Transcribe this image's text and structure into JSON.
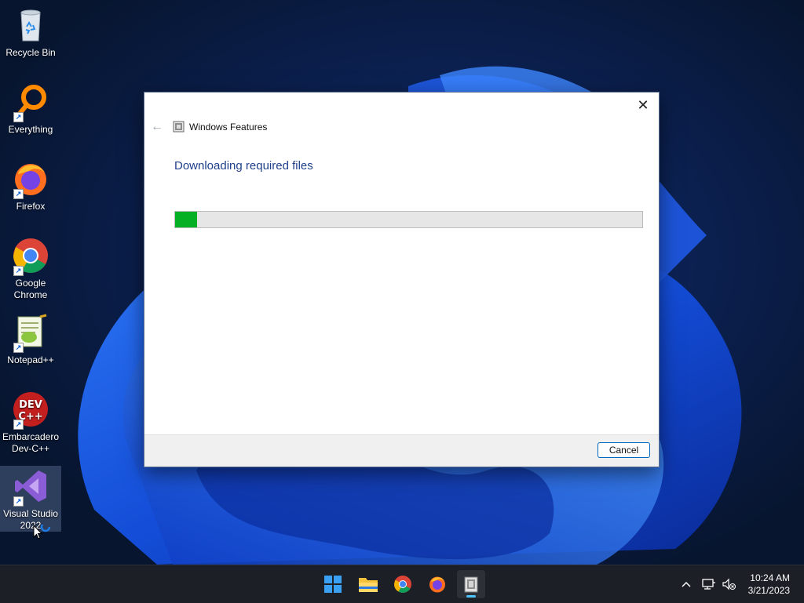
{
  "desktop": {
    "icons": [
      {
        "label": "Recycle Bin",
        "icon": "recycle-bin-icon"
      },
      {
        "label": "Everything",
        "icon": "everything-search-icon"
      },
      {
        "label": "Firefox",
        "icon": "firefox-icon"
      },
      {
        "label": "Google Chrome",
        "icon": "chrome-icon"
      },
      {
        "label": "Notepad++",
        "icon": "notepadpp-icon"
      },
      {
        "label": "Embarcadero Dev-C++",
        "icon": "devcpp-icon"
      },
      {
        "label": "Visual Studio 2022",
        "icon": "visual-studio-icon"
      }
    ]
  },
  "dialog": {
    "title": "Windows Features",
    "heading": "Downloading required files",
    "progress_percent": 4.7,
    "cancel_label": "Cancel",
    "close_glyph": "✕",
    "back_glyph": "←"
  },
  "taskbar": {
    "apps": [
      "windows-start-icon",
      "file-explorer-icon",
      "chrome-icon",
      "firefox-icon",
      "windows-features-icon"
    ],
    "clock_time": "10:24 AM",
    "clock_date": "3/21/2023"
  },
  "colors": {
    "progress_fill": "#06b025",
    "heading": "#1f3f8a",
    "accent": "#0067c0"
  }
}
